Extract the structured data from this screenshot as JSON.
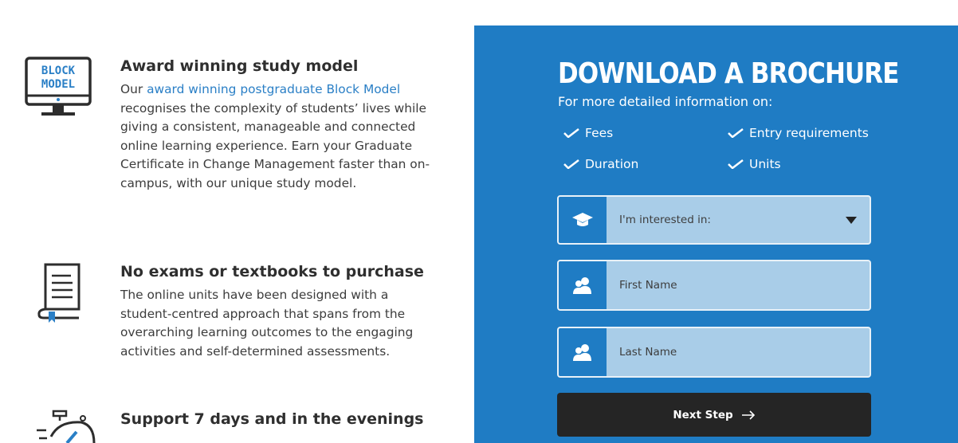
{
  "features": [
    {
      "icon": "block-model-monitor-icon",
      "icon_text": [
        "BLOCK",
        "MODEL"
      ],
      "title": "Award winning study model",
      "body_prefix": "Our ",
      "link": "award winning postgraduate Block Model",
      "body_suffix": " recognises the complexity of students’ lives while giving a consistent, manageable and connected online learning experience. Earn your Graduate Certificate in Change Management faster than on-campus, with our unique study model."
    },
    {
      "icon": "book-icon",
      "title": "No exams or textbooks to purchase",
      "body": "The online units have been designed with a student-centred approach that spans from the overarching learning outcomes to the engaging activities and self-determined assessments."
    },
    {
      "icon": "stopwatch-icon",
      "title": "Support 7 days and in the evenings"
    }
  ],
  "brochure": {
    "heading": "DOWNLOAD A BROCHURE",
    "subheading": "For more detailed information on:",
    "checks": [
      "Fees",
      "Entry requirements",
      "Duration",
      "Units"
    ],
    "interest_label": "I'm interested in:",
    "first_name_placeholder": "First Name",
    "last_name_placeholder": "Last Name",
    "next_label": "Next Step",
    "colors": {
      "panel": "#1f7cc4",
      "field": "#a9cde8",
      "button": "#252525",
      "link": "#2a7fc6"
    }
  }
}
